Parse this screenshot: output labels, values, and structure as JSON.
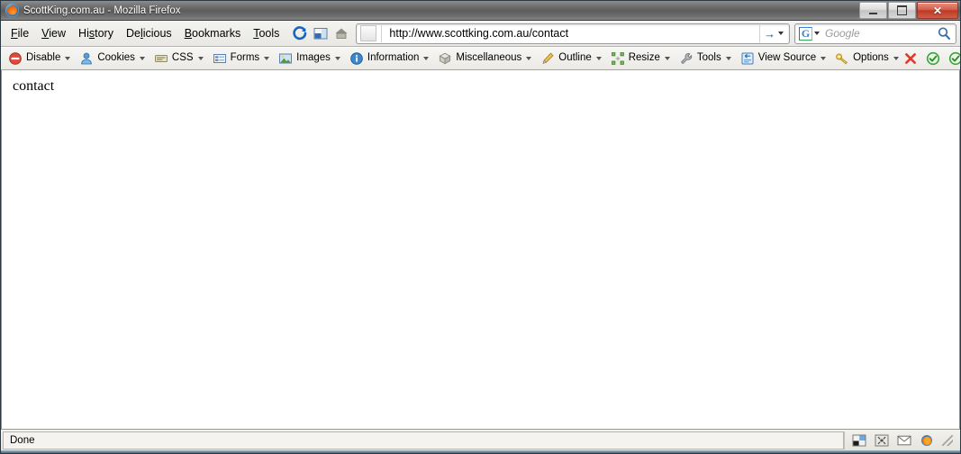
{
  "window": {
    "title": "ScottKing.com.au - Mozilla Firefox",
    "app_icon": "firefox-icon",
    "controls": {
      "minimize": "minimize-button",
      "maximize": "maximize-button",
      "close_label": "✕"
    }
  },
  "menu": {
    "items": [
      {
        "label": "File",
        "accel_index": 0
      },
      {
        "label": "View",
        "accel_index": 0
      },
      {
        "label": "History",
        "accel_index": 2
      },
      {
        "label": "Delicious",
        "accel_index": 2
      },
      {
        "label": "Bookmarks",
        "accel_index": 0
      },
      {
        "label": "Tools",
        "accel_index": 0
      }
    ]
  },
  "navbar": {
    "icons": [
      {
        "name": "reload-icon"
      },
      {
        "name": "sidebar-panel-icon"
      },
      {
        "name": "home-icon"
      }
    ],
    "url": "http://www.scottking.com.au/contact",
    "favicon": "page-favicon",
    "go_arrow": "→",
    "go_dropdown": "go-dropdown-icon"
  },
  "search": {
    "engine_letter": "G",
    "engine_name": "google-engine-icon",
    "placeholder": "Google",
    "value": "",
    "magnifier": "search-magnifier-icon"
  },
  "devtoolbar": {
    "items": [
      {
        "label": "Disable",
        "icon": "disable-icon",
        "has_menu": true
      },
      {
        "label": "Cookies",
        "icon": "cookies-icon",
        "has_menu": true
      },
      {
        "label": "CSS",
        "icon": "css-icon",
        "has_menu": true
      },
      {
        "label": "Forms",
        "icon": "forms-icon",
        "has_menu": true
      },
      {
        "label": "Images",
        "icon": "images-icon",
        "has_menu": true
      },
      {
        "label": "Information",
        "icon": "information-icon",
        "has_menu": true
      },
      {
        "label": "Miscellaneous",
        "icon": "miscellaneous-icon",
        "has_menu": true
      },
      {
        "label": "Outline",
        "icon": "outline-icon",
        "has_menu": true
      },
      {
        "label": "Resize",
        "icon": "resize-icon",
        "has_menu": true
      },
      {
        "label": "Tools",
        "icon": "tools-icon",
        "has_menu": true
      },
      {
        "label": "View Source",
        "icon": "view-source-icon",
        "has_menu": true
      },
      {
        "label": "Options",
        "icon": "options-icon",
        "has_menu": true
      }
    ],
    "status_icons": [
      {
        "name": "error-indicator-icon",
        "color": "#e03a28"
      },
      {
        "name": "css-validator-icon",
        "color": "#3aa33a"
      },
      {
        "name": "html-validator-icon",
        "color": "#3aa33a"
      }
    ]
  },
  "page": {
    "body_text": "contact"
  },
  "statusbar": {
    "status": "Done",
    "icons": [
      {
        "name": "adblock-status-icon"
      },
      {
        "name": "noscript-status-icon"
      },
      {
        "name": "mail-status-icon"
      },
      {
        "name": "firefox-status-icon"
      }
    ],
    "resize_grip": "resize-grip"
  },
  "colors": {
    "accent_blue": "#1c4f9c",
    "close_red": "#bb3a24",
    "toolbar_bg": "#eceae5",
    "titlebar_dark": "#5c5c5c"
  }
}
